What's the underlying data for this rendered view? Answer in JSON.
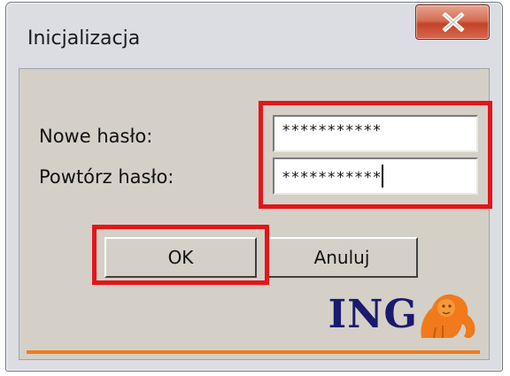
{
  "window": {
    "title": "Inicjalizacja"
  },
  "form": {
    "new_password_label": "Nowe hasło:",
    "new_password_value": "***********",
    "repeat_password_label": "Powtórz hasło:",
    "repeat_password_value": "***********"
  },
  "buttons": {
    "ok_label": "OK",
    "cancel_label": "Anuluj"
  },
  "branding": {
    "logo_text": "ING"
  },
  "icons": {
    "close": "close-icon",
    "logo": "ing-lion-icon"
  },
  "colors": {
    "highlight": "#e3151a",
    "brand_orange": "#f07a1c",
    "brand_blue": "#1a1a6e"
  }
}
